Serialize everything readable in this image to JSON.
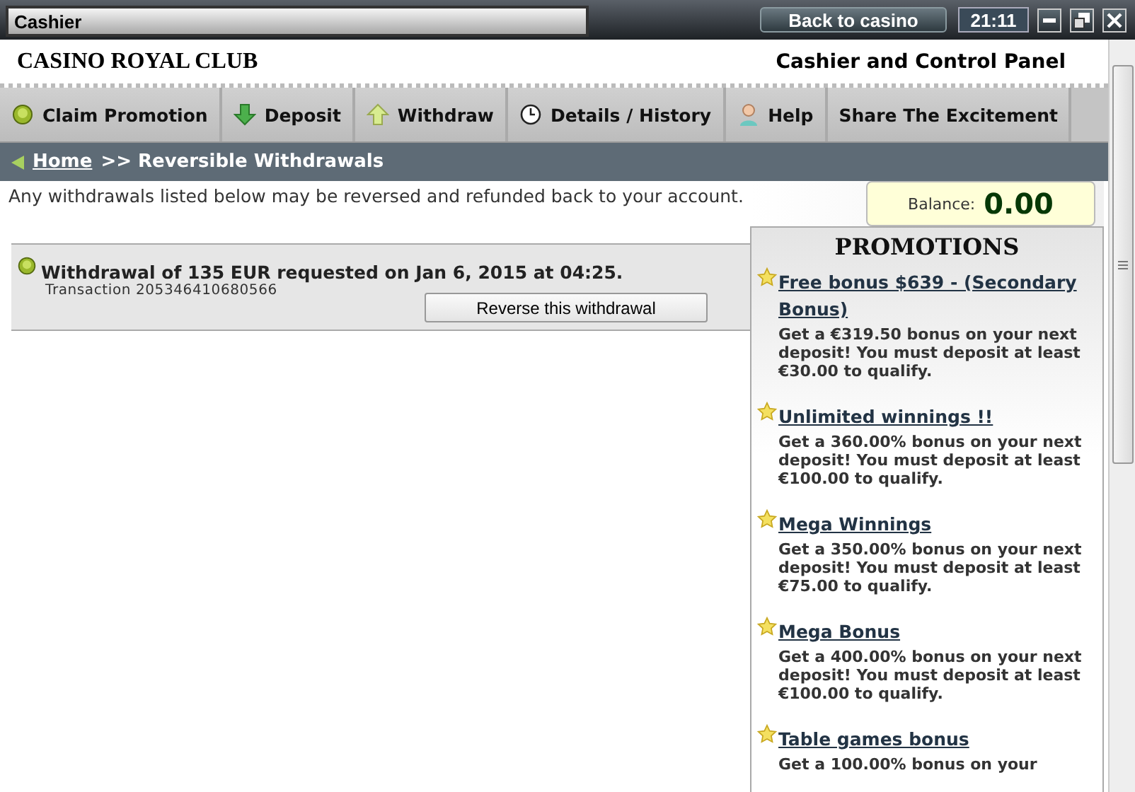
{
  "window": {
    "title": "Cashier",
    "back_button": "Back to casino",
    "clock": "21:11"
  },
  "header": {
    "brand": "CASINO ROYAL CLUB",
    "subtitle": "Cashier and Control Panel"
  },
  "nav": [
    {
      "label": "Claim Promotion"
    },
    {
      "label": "Deposit"
    },
    {
      "label": "Withdraw"
    },
    {
      "label": "Details / History"
    },
    {
      "label": "Help"
    },
    {
      "label": "Share The Excitement"
    }
  ],
  "breadcrumb": {
    "home": "Home",
    "current": ">> Reversible Withdrawals"
  },
  "intro": "Any withdrawals listed below may be reversed and refunded back to your account.",
  "withdrawals": [
    {
      "title": "Withdrawal of 135 EUR requested on Jan 6, 2015 at 04:25.",
      "transaction": "Transaction 205346410680566",
      "button": "Reverse this withdrawal"
    }
  ],
  "balance": {
    "label": "Balance:",
    "value": "0.00"
  },
  "promotions": {
    "title": "PROMOTIONS",
    "items": [
      {
        "title": "Free bonus $639 - (Secondary Bonus)",
        "text": "Get a €319.50 bonus on your next deposit! You must deposit at least €30.00 to qualify."
      },
      {
        "title": "Unlimited winnings !!",
        "text": "Get a 360.00% bonus on your next deposit! You must deposit at least €100.00 to qualify."
      },
      {
        "title": "Mega Winnings",
        "text": "Get a 350.00% bonus on your next deposit! You must deposit at least €75.00 to qualify."
      },
      {
        "title": "Mega Bonus",
        "text": "Get a 400.00% bonus on your next deposit! You must deposit at least €100.00 to qualify."
      },
      {
        "title": "Table games bonus",
        "text": "Get a 100.00% bonus on your"
      }
    ]
  }
}
